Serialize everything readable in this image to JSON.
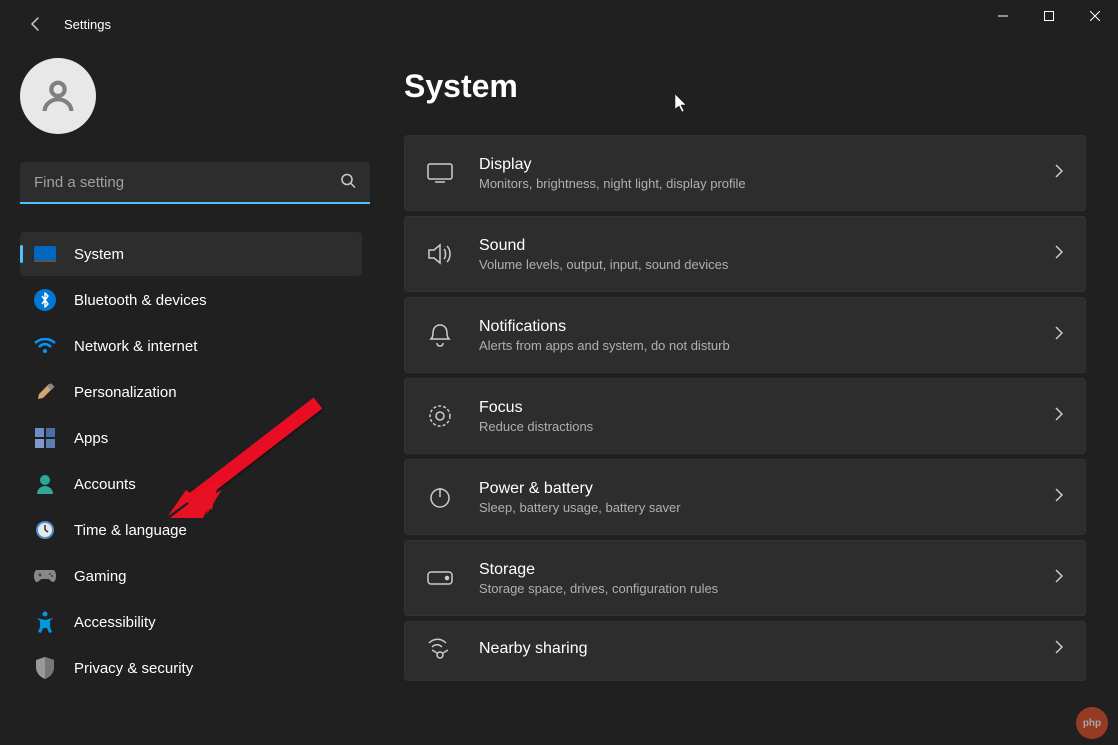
{
  "window": {
    "title": "Settings"
  },
  "search": {
    "placeholder": "Find a setting"
  },
  "sidebar": {
    "items": [
      {
        "label": "System"
      },
      {
        "label": "Bluetooth & devices"
      },
      {
        "label": "Network & internet"
      },
      {
        "label": "Personalization"
      },
      {
        "label": "Apps"
      },
      {
        "label": "Accounts"
      },
      {
        "label": "Time & language"
      },
      {
        "label": "Gaming"
      },
      {
        "label": "Accessibility"
      },
      {
        "label": "Privacy & security"
      }
    ]
  },
  "page": {
    "title": "System"
  },
  "cards": [
    {
      "title": "Display",
      "sub": "Monitors, brightness, night light, display profile"
    },
    {
      "title": "Sound",
      "sub": "Volume levels, output, input, sound devices"
    },
    {
      "title": "Notifications",
      "sub": "Alerts from apps and system, do not disturb"
    },
    {
      "title": "Focus",
      "sub": "Reduce distractions"
    },
    {
      "title": "Power & battery",
      "sub": "Sleep, battery usage, battery saver"
    },
    {
      "title": "Storage",
      "sub": "Storage space, drives, configuration rules"
    },
    {
      "title": "Nearby sharing",
      "sub": ""
    }
  ],
  "watermark": {
    "text": ""
  }
}
